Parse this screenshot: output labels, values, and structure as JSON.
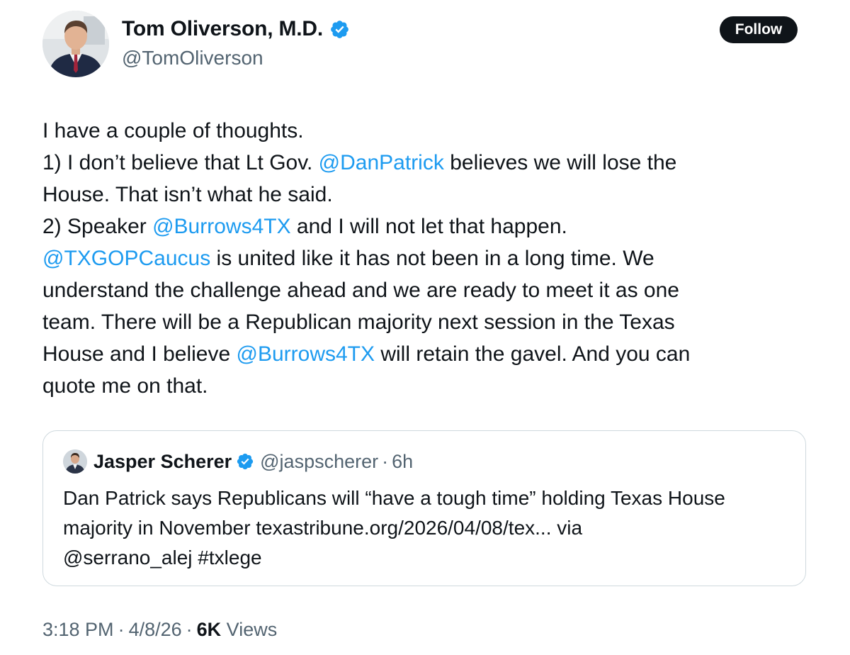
{
  "author": {
    "name": "Tom Oliverson, M.D.",
    "handle": "@TomOliverson",
    "follow_label": "Follow"
  },
  "tweet": {
    "lines": [
      [
        {
          "t": "I have a couple of thoughts."
        }
      ],
      [
        {
          "t": "1) I don’t believe that Lt Gov. "
        },
        {
          "t": "@DanPatrick",
          "mention": true
        },
        {
          "t": " believes we will lose the"
        }
      ],
      [
        {
          "t": "House.  That isn’t what he said."
        }
      ],
      [
        {
          "t": "2) Speaker "
        },
        {
          "t": "@Burrows4TX",
          "mention": true
        },
        {
          "t": " and I will not let that happen."
        }
      ],
      [
        {
          "t": "@TXGOPCaucus",
          "mention": true
        },
        {
          "t": " is united like it has not been in a long time.  We"
        }
      ],
      [
        {
          "t": "understand the challenge ahead and we are ready to meet it as one"
        }
      ],
      [
        {
          "t": "team.  There will be a Republican majority next session in the Texas"
        }
      ],
      [
        {
          "t": "House and I believe "
        },
        {
          "t": "@Burrows4TX",
          "mention": true
        },
        {
          "t": " will retain the gavel.  And you can"
        }
      ],
      [
        {
          "t": "quote me on that."
        }
      ]
    ]
  },
  "quoted": {
    "name": "Jasper Scherer",
    "handle": "@jaspscherer",
    "separator": "·",
    "time": "6h",
    "lines": [
      "Dan Patrick says Republicans will “have a tough time” holding Texas House",
      "majority in November texastribune.org/2026/04/08/tex... via",
      "@serrano_alej #txlege"
    ]
  },
  "meta": {
    "time": "3:18 PM",
    "separator": "·",
    "date": "4/8/26",
    "views_count": "6K",
    "views_label": "Views"
  },
  "colors": {
    "text": "#0f1419",
    "secondary": "#536471",
    "accent": "#1d9bf0",
    "border": "#cfd9de",
    "verified": "#1d9bf0"
  },
  "icons": {
    "verified": "verified-badge-icon",
    "avatar": "profile-photo",
    "quoted_avatar": "profile-photo"
  }
}
